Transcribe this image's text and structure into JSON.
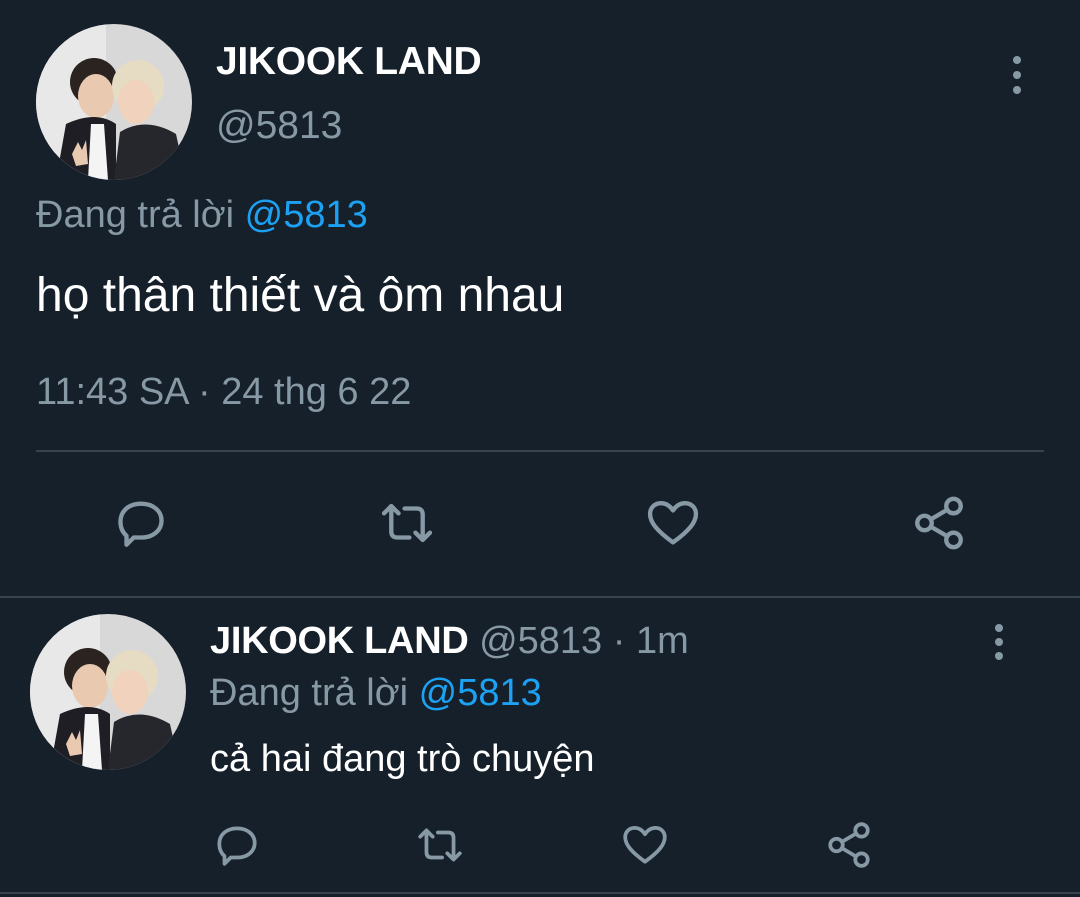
{
  "main_tweet": {
    "display_name": "JIKOOK LAND",
    "handle": "@5813",
    "replying_prefix": "Đang trả lời",
    "replying_to": "@5813",
    "text": "họ thân thiết và ôm nhau",
    "timestamp": "11:43 SA · 24 thg 6 22"
  },
  "reply_tweet": {
    "display_name": "JIKOOK LAND",
    "handle": "@5813",
    "separator": "·",
    "age": "1m",
    "replying_prefix": "Đang trả lời",
    "replying_to": "@5813",
    "text": "cả hai đang trò chuyện"
  },
  "actions": [
    "reply-icon",
    "retweet-icon",
    "like-icon",
    "share-icon"
  ],
  "colors": {
    "background": "#15202b",
    "text": "#ffffff",
    "secondary": "#8899a6",
    "accent": "#1da1f2",
    "divider": "#38444d"
  }
}
